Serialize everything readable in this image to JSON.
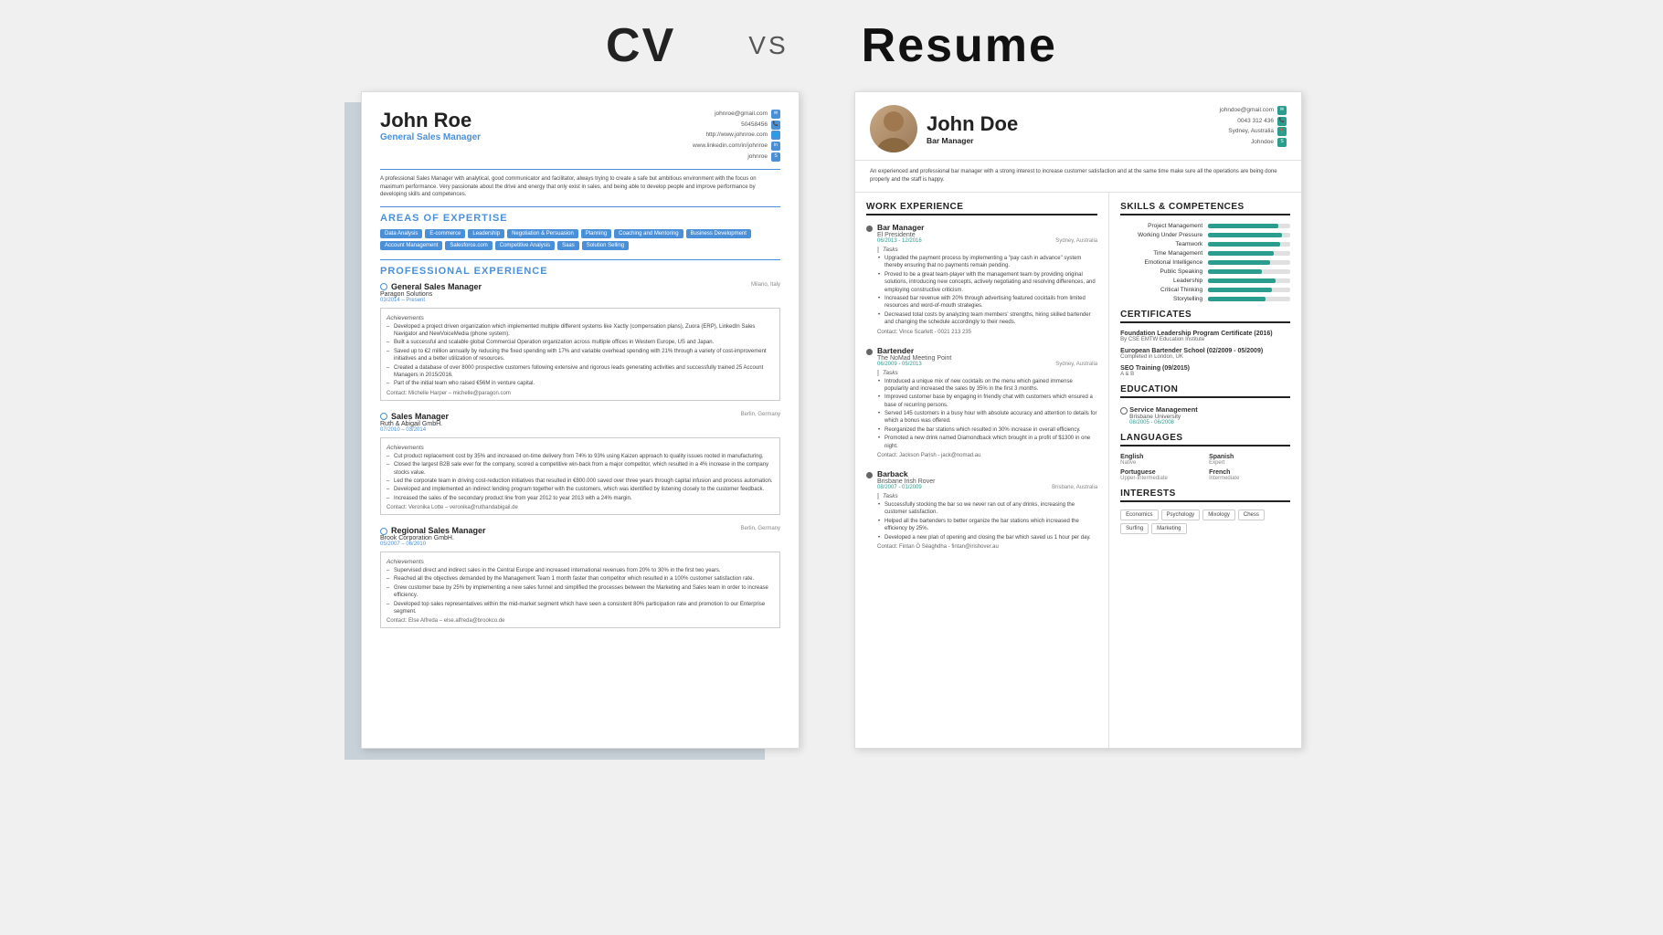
{
  "header": {
    "cv_label": "CV",
    "vs_label": "VS",
    "resume_label": "Resume"
  },
  "cv": {
    "name": "John Roe",
    "title": "General Sales Manager",
    "contact": {
      "email": "johnroe@gmail.com",
      "phone": "50458456",
      "website": "http://www.johnroe.com",
      "linkedin": "www.linkedin.com/in/johnroe",
      "skype": "johnroe"
    },
    "summary": "A professional Sales Manager with analytical, good communicator and facilitator, always trying to create a safe but ambitious environment with the focus on maximum performance. Very passionate about the drive and energy that only exist in sales, and being able to develop people and improve performance by developing skills and competences.",
    "areas_of_expertise_title": "AREAS OF EXPERTISE",
    "tags": [
      "Data Analysis",
      "E-commerce",
      "Leadership",
      "Negotiation & Persuasion",
      "Planning",
      "Coaching and Mentoring",
      "Business Development",
      "Account Management",
      "Salesforce.com",
      "Competitive Analysis",
      "Saas",
      "Solution Selling"
    ],
    "professional_experience_title": "PROFESSIONAL EXPERIENCE",
    "jobs": [
      {
        "title": "General Sales Manager",
        "company": "Paragon Solutions",
        "date": "03/2014 – Present",
        "location": "Milano, Italy",
        "achievements": [
          "Developed a project driven organization which implemented multiple different systems like Xactly (compensation plans), Zuora (ERP), LinkedIn Sales Navigator and NewVoiceMedia (phone system).",
          "Built a successful and scalable global Commercial Operation organization across multiple offices in Western Europe, US and Japan.",
          "Saved up to €2 million annually by reducing the fixed spending with 17% and variable overhead spending with 21% through a variety of cost-improvement initiatives and a better utilization of resources.",
          "Created a database of over 8000 prospective customers following extensive and rigorous leads generating activities and successfully trained 25 Account Managers in 2015/2016.",
          "Part of the initial team who raised €56M in venture capital."
        ],
        "contact": "Contact: Michelle Harper – michelle@paragon.com"
      },
      {
        "title": "Sales Manager",
        "company": "Ruth & Abigail GmbH.",
        "date": "07/2010 – 03/2014",
        "location": "Berlin, Germany",
        "achievements": [
          "Cut product replacement cost by 35% and increased on-time delivery from 74% to 93% using Kaizen approach to quality issues rooted in manufacturing.",
          "Closed the largest B2B sale ever for the company, scored a competitive win-back from a major competitor, which resulted in a 4% increase in the company stocks value.",
          "Led the corporate team in driving cost-reduction initiatives that resulted in €800.000 saved over three years through capital infusion and process automation.",
          "Developed and implemented an indirect lending program together with the customers, which was identified by listening closely to the customer feedback.",
          "Increased the sales of the secondary product line from year 2012 to year 2013 with a 24% margin."
        ],
        "contact": "Contact: Veronika Lotte – veronika@ruthandabigail.de"
      },
      {
        "title": "Regional Sales Manager",
        "company": "Brook Corporation GmbH.",
        "date": "05/2007 – 06/2010",
        "location": "Berlin, Germany",
        "achievements": [
          "Supervised direct and indirect sales in the Central Europe and increased international revenues from 20% to 30% in the first two years.",
          "Reached all the objectives demanded by the Management Team 1 month faster than competitor which resulted in a 100% customer satisfaction rate.",
          "Grew customer base by 25% by implementing a new sales funnel and simplified the processes between the Marketing and Sales team in order to increase efficiency.",
          "Developed top sales representatives within the mid-market segment which have seen a consistent 80% participation rate and promotion to our Enterprise segment."
        ],
        "contact": "Contact: Else Alfreda – else.alfreda@brookco.de"
      }
    ]
  },
  "resume": {
    "name": "John Doe",
    "title": "Bar Manager",
    "contact": {
      "email": "johndoe@gmail.com",
      "phone": "0043 312 436",
      "location": "Sydney, Australia",
      "skype": "Johndoe"
    },
    "summary": "An experienced and professional bar manager with a strong interest to increase customer satisfaction and at the same time make sure all the operations are being done properly and the staff is happy.",
    "work_experience_title": "WORK EXPERIENCE",
    "jobs": [
      {
        "title": "Bar Manager",
        "company": "El Presidente",
        "date": "06/2013 - 12/2016",
        "location": "Sydney, Australia",
        "tasks": [
          "Upgraded the payment process by implementing a \"pay cash in advance\" system thereby ensuring that no payments remain pending.",
          "Proved to be a great team-player with the management team by providing original solutions, introducing new concepts, actively negotiating and resolving differences, and employing constructive criticism.",
          "Increased bar revenue with 20% through advertising featured cocktails from limited resources and word-of-mouth strategies.",
          "Decreased total costs by analyzing team members' strengths, hiring skilled bartender and changing the schedule accordingly to their needs."
        ],
        "contact": "Contact: Vince Scarlett - 0021 213 235"
      },
      {
        "title": "Bartender",
        "company": "The NoMad Meeting Point",
        "date": "06/2009 - 05/2013",
        "location": "Sydney, Australia",
        "tasks": [
          "Introduced a unique mix of new cocktails on the menu which gained immense popularity and increased the sales by 35% in the first 3 months.",
          "Improved customer base by engaging in friendly chat with customers which ensured a base of recurring persons.",
          "Served 145 customers in a busy hour with absolute accuracy and attention to details for which a bonus was offered.",
          "Reorganized the bar stations which resulted in 30% increase in overall efficiency.",
          "Promoted a new drink named Diamondback which brought in a profit of $1300 in one night."
        ],
        "contact": "Contact: Jackson Parish - jack@nomad.au"
      },
      {
        "title": "Barback",
        "company": "Brisbane Irish Rover",
        "date": "08/2007 - 01/2009",
        "location": "Brisbane, Australia",
        "tasks": [
          "Successfully stocking the bar so we never ran out of any drinks, increasing the customer satisfaction.",
          "Helped all the bartenders to better organize the bar stations which increased the efficiency by 25%.",
          "Developed a new plan of opening and closing the bar which saved us 1 hour per day."
        ],
        "contact": "Contact: Fintan Ó Séaghdha - fintan@irishover.au"
      }
    ],
    "skills_title": "SKILLS & COMPETENCES",
    "skills": [
      {
        "name": "Project Management",
        "pct": 85
      },
      {
        "name": "Working Under Pressure",
        "pct": 90
      },
      {
        "name": "Teamwork",
        "pct": 88
      },
      {
        "name": "Time Management",
        "pct": 80
      },
      {
        "name": "Emotional Intelligence",
        "pct": 75
      },
      {
        "name": "Public Speaking",
        "pct": 65
      },
      {
        "name": "Leadership",
        "pct": 82
      },
      {
        "name": "Critical Thinking",
        "pct": 78
      },
      {
        "name": "Storytelling",
        "pct": 70
      }
    ],
    "certificates_title": "CERTIFICATES",
    "certificates": [
      {
        "title": "Foundation Leadership Program Certificate (2016)",
        "sub": "By CSE EMTW Education Institute"
      },
      {
        "title": "European Bartender School (02/2009 - 05/2009)",
        "sub": "Completed in London, UK"
      },
      {
        "title": "SEO Training (09/2015)",
        "sub": "A & B"
      }
    ],
    "education_title": "EDUCATION",
    "education": [
      {
        "title": "Service Management",
        "school": "Brisbane University",
        "date": "08/2005 - 06/2008"
      }
    ],
    "languages_title": "LANGUAGES",
    "languages": [
      {
        "name": "English",
        "level": "Native"
      },
      {
        "name": "Spanish",
        "level": "Expert"
      },
      {
        "name": "Portuguese",
        "level": "Upper-Intermediate"
      },
      {
        "name": "French",
        "level": "Intermediate"
      }
    ],
    "interests_title": "INTERESTS",
    "interests": [
      "Economics",
      "Psychology",
      "Mixology",
      "Chess",
      "Surfing",
      "Marketing"
    ]
  }
}
